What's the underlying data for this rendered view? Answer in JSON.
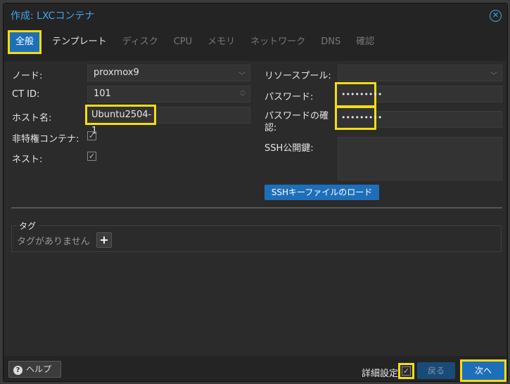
{
  "dialog": {
    "title": "作成: LXCコンテナ",
    "close_icon": "close-circle-icon"
  },
  "tabs": [
    {
      "label": "全般",
      "state": "active"
    },
    {
      "label": "テンプレート",
      "state": "enabled"
    },
    {
      "label": "ディスク",
      "state": "disabled"
    },
    {
      "label": "CPU",
      "state": "disabled"
    },
    {
      "label": "メモリ",
      "state": "disabled"
    },
    {
      "label": "ネットワーク",
      "state": "disabled"
    },
    {
      "label": "DNS",
      "state": "disabled"
    },
    {
      "label": "確認",
      "state": "disabled"
    }
  ],
  "form": {
    "node": {
      "label": "ノード:",
      "value": "proxmox9"
    },
    "ct_id": {
      "label": "CT ID:",
      "value": "101"
    },
    "hostname": {
      "label": "ホスト名:",
      "value": "Ubuntu2504-1"
    },
    "unprivileged": {
      "label": "非特権コンテナ:",
      "checked": true
    },
    "nesting": {
      "label": "ネスト:",
      "checked": true
    },
    "resource_pool": {
      "label": "リソースプール:",
      "value": ""
    },
    "password": {
      "label": "パスワード:",
      "value": "•••••••••"
    },
    "password_confirm": {
      "label_line1": "パスワードの確",
      "label_line2": "認:",
      "value": "•••••••••"
    },
    "ssh_key": {
      "label": "SSH公開鍵:",
      "value": ""
    },
    "ssh_load_button": "SSHキーファイルのロード"
  },
  "tags": {
    "legend": "タグ",
    "empty_text": "タグがありません",
    "add_icon": "plus-icon"
  },
  "footer": {
    "help_label": "ヘルプ",
    "help_icon": "question-circle-icon",
    "advanced_label": "詳細設定",
    "advanced_checked": true,
    "back_label": "戻る",
    "next_label": "次へ"
  },
  "colors": {
    "accent": "#1e6fba",
    "title": "#43a4e8",
    "highlight": "#f5dc14",
    "background": "#242424"
  }
}
